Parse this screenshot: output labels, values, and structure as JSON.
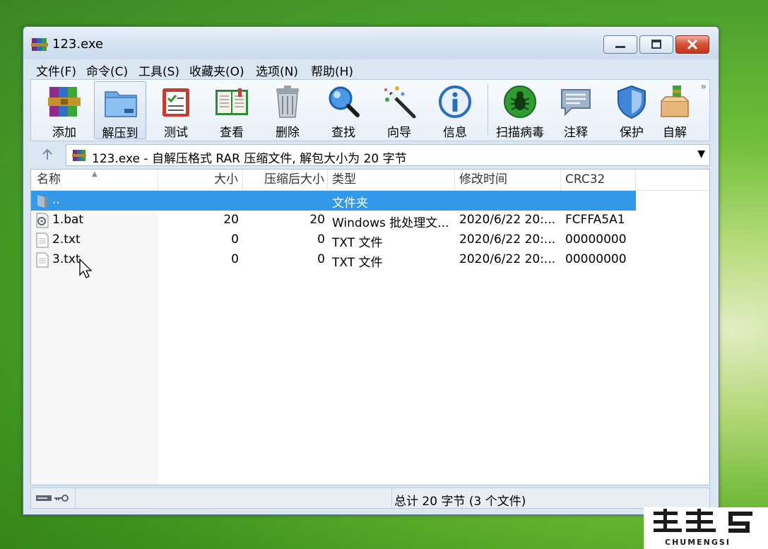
{
  "window": {
    "title": "123.exe"
  },
  "menu": [
    "文件(F)",
    "命令(C)",
    "工具(S)",
    "收藏夹(O)",
    "选项(N)",
    "帮助(H)"
  ],
  "toolbar": [
    {
      "label": "添加",
      "icon": "books-archive-icon"
    },
    {
      "label": "解压到",
      "icon": "folder-extract-icon"
    },
    {
      "label": "测试",
      "icon": "checklist-icon"
    },
    {
      "label": "查看",
      "icon": "open-book-icon"
    },
    {
      "label": "删除",
      "icon": "trash-bin-icon"
    },
    {
      "label": "查找",
      "icon": "magnifier-icon"
    },
    {
      "label": "向导",
      "icon": "magic-wand-icon"
    },
    {
      "label": "信息",
      "icon": "info-icon"
    },
    {
      "label": "扫描病毒",
      "icon": "virus-scan-icon"
    },
    {
      "label": "注释",
      "icon": "comment-icon"
    },
    {
      "label": "保护",
      "icon": "shield-icon"
    },
    {
      "label": "自解",
      "icon": "sfx-box-icon"
    }
  ],
  "address": {
    "text": "123.exe - 自解压格式 RAR 压缩文件, 解包大小为 20 字节"
  },
  "columns": [
    "名称",
    "大小",
    "压缩后大小",
    "类型",
    "修改时间",
    "CRC32"
  ],
  "rows": [
    {
      "name": "..",
      "size": "",
      "packed": "",
      "type": "文件夹",
      "modified": "",
      "crc": "",
      "icon": "folder-up-icon",
      "selected": true
    },
    {
      "name": "1.bat",
      "size": "20",
      "packed": "20",
      "type": "Windows 批处理文...",
      "modified": "2020/6/22 20:...",
      "crc": "FCFFA5A1",
      "icon": "batch-file-icon",
      "selected": false
    },
    {
      "name": "2.txt",
      "size": "0",
      "packed": "0",
      "type": "TXT 文件",
      "modified": "2020/6/22 20:...",
      "crc": "00000000",
      "icon": "text-file-icon",
      "selected": false
    },
    {
      "name": "3.txt",
      "size": "0",
      "packed": "0",
      "type": "TXT 文件",
      "modified": "2020/6/22 20:...",
      "crc": "00000000",
      "icon": "text-file-icon",
      "selected": false
    }
  ],
  "status": {
    "summary": "总计 20 字节 (3 个文件)"
  },
  "watermark": {
    "text": "CHUMENGSI"
  }
}
